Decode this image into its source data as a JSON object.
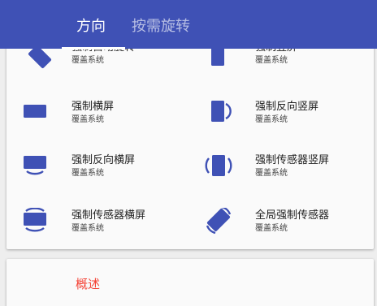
{
  "colors": {
    "primary": "#3f51b5",
    "accent": "#f44336",
    "icon": "#3f51b5",
    "card": "#fafafa",
    "background": "#eeeeee"
  },
  "tabs": [
    {
      "label": "方向",
      "selected": true
    },
    {
      "label": "按需旋转",
      "selected": false
    }
  ],
  "modes": [
    {
      "title": "强制自动旋转",
      "subtitle": "覆盖系统",
      "icon": "auto-rotate-icon"
    },
    {
      "title": "强制竖屏",
      "subtitle": "覆盖系统",
      "icon": "portrait-icon"
    },
    {
      "title": "强制横屏",
      "subtitle": "覆盖系统",
      "icon": "landscape-icon"
    },
    {
      "title": "强制反向竖屏",
      "subtitle": "覆盖系统",
      "icon": "reverse-portrait-icon"
    },
    {
      "title": "强制反向横屏",
      "subtitle": "覆盖系统",
      "icon": "reverse-landscape-icon"
    },
    {
      "title": "强制传感器竖屏",
      "subtitle": "覆盖系统",
      "icon": "sensor-portrait-icon"
    },
    {
      "title": "强制传感器横屏",
      "subtitle": "覆盖系统",
      "icon": "sensor-landscape-icon"
    },
    {
      "title": "全局强制传感器",
      "subtitle": "覆盖系统",
      "icon": "full-sensor-icon"
    }
  ],
  "summary": {
    "title": "概述"
  }
}
